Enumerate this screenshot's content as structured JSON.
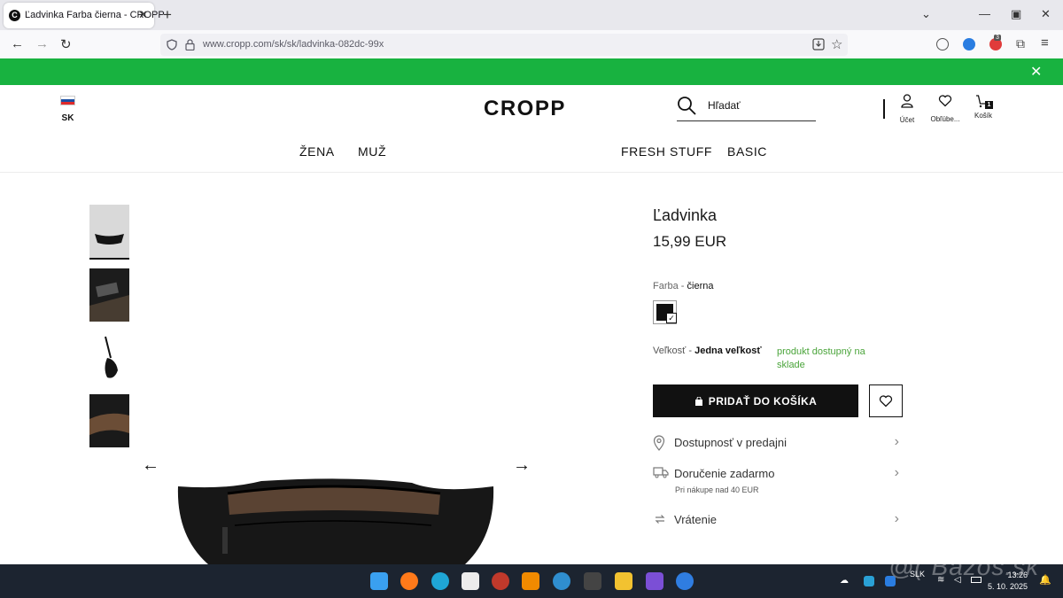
{
  "browser": {
    "tab_title": "Ľadvinka Farba čierna - CROPP",
    "tab_favicon_letter": "C",
    "new_tab_label": "+",
    "url": "www.cropp.com/sk/sk/ladvinka-082dc-99x",
    "extension_badge": "3",
    "icons": [
      "back-icon",
      "forward-icon",
      "reload-icon",
      "shield-icon",
      "lock-icon",
      "download-icon",
      "bookmark-star-icon",
      "tab-list-chevron-icon",
      "minimize-icon",
      "restore-icon",
      "close-icon",
      "account-icon",
      "extension-icon",
      "puzzle-icon",
      "menu-icon"
    ]
  },
  "promo_bar": {
    "color": "#18b240",
    "close_label": "✕"
  },
  "header": {
    "country_code": "SK",
    "logo": "CROPP",
    "search_placeholder": "Hľadať",
    "account_label": "Účet",
    "favorites_label": "Obľúbe...",
    "cart_label": "Košík",
    "cart_count": "1"
  },
  "main_nav": {
    "women": "ŽENA",
    "men": "MUŽ",
    "fresh": "FRESH STUFF",
    "basic": "BASIC"
  },
  "product": {
    "name": "Ľadvinka",
    "price": "15,99 EUR",
    "color_label": "Farba",
    "color_sep": " - ",
    "color_value": "čierna",
    "swatch_color": "#111111",
    "size_label": "Veľkosť - ",
    "size_value": "Jedna veľkosť",
    "stock_text": "produkt dostupný na sklade",
    "add_to_cart": "PRIDAŤ DO KOŠÍKA",
    "info": {
      "store_availability": "Dostupnosť v predajni",
      "delivery": "Doručenie zadarmo",
      "delivery_note": "Pri nákupe nad 40 EUR",
      "returns": "Vrátenie"
    }
  },
  "taskbar": {
    "lang": "SLK",
    "time": "13:26",
    "date": "5. 10. 2025"
  },
  "watermark": "@( Bazos.sk"
}
